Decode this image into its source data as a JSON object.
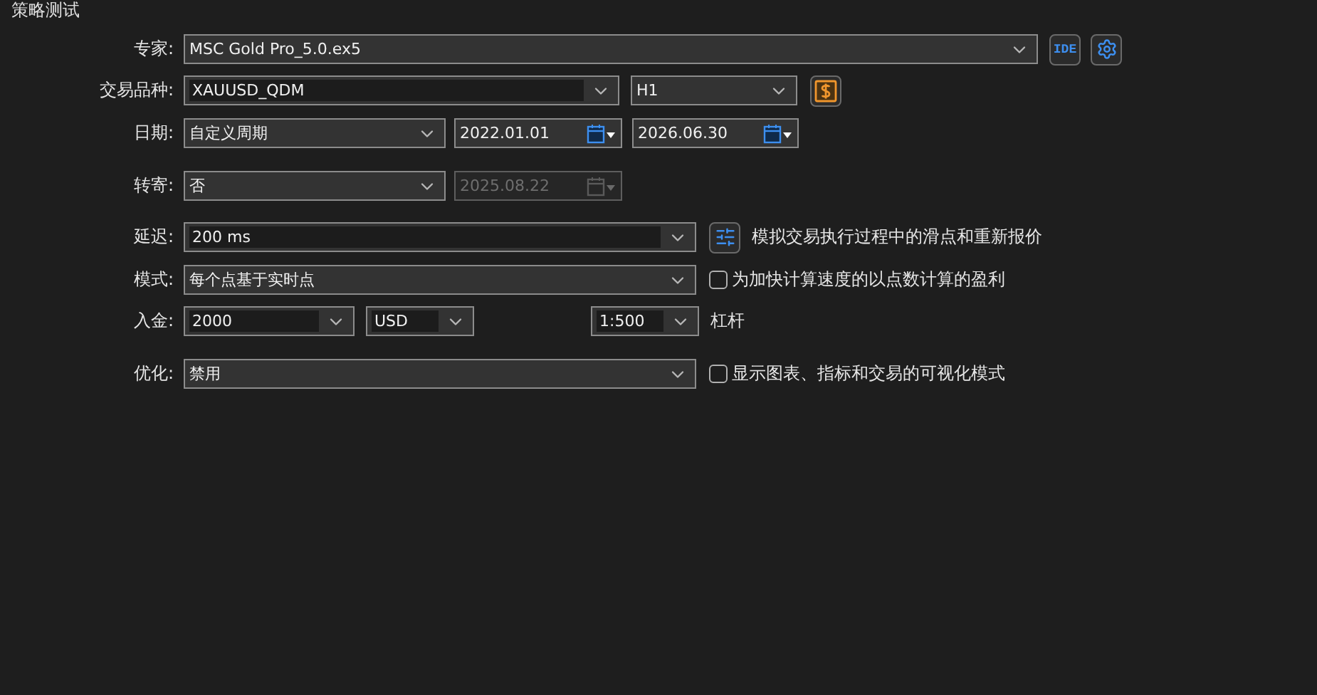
{
  "title": "策略测试",
  "rows": [
    {
      "label": "专家:",
      "controls": [
        {
          "kind": "select",
          "value": "MSC Gold Pro_5.0.ex5"
        },
        {
          "kind": "ide_button",
          "label": "IDE"
        },
        {
          "kind": "settings_button"
        }
      ]
    },
    {
      "label": "交易品种:",
      "controls": [
        {
          "kind": "combo",
          "value": "XAUUSD_QDM"
        },
        {
          "kind": "select",
          "value": "H1"
        },
        {
          "kind": "money_button"
        }
      ]
    },
    {
      "label": "日期:",
      "controls": [
        {
          "kind": "select",
          "value": "自定义周期"
        },
        {
          "kind": "date",
          "value": "2022.01.01",
          "disabled": false
        },
        {
          "kind": "date",
          "value": "2026.06.30",
          "disabled": false
        }
      ]
    },
    {
      "label": "转寄:",
      "controls": [
        {
          "kind": "select",
          "value": "否"
        },
        {
          "kind": "date",
          "value": "2025.08.22",
          "disabled": true
        }
      ]
    },
    {
      "label": "延迟:",
      "controls": [
        {
          "kind": "combo",
          "value": "200 ms"
        },
        {
          "kind": "sliders_button"
        },
        {
          "kind": "text",
          "label": "模拟交易执行过程中的滑点和重新报价"
        }
      ]
    },
    {
      "label": "模式:",
      "controls": [
        {
          "kind": "select",
          "value": "每个点基于实时点"
        },
        {
          "kind": "checkbox",
          "label": "为加快计算速度的以点数计算的盈利",
          "checked": false
        }
      ]
    },
    {
      "label": "入金:",
      "controls": [
        {
          "kind": "combo",
          "value": "2000"
        },
        {
          "kind": "combo",
          "value": "USD"
        },
        {
          "kind": "combo",
          "value": "1:500"
        },
        {
          "kind": "text",
          "label": "杠杆"
        }
      ]
    },
    {
      "label": "优化:",
      "controls": [
        {
          "kind": "select",
          "value": "禁用"
        },
        {
          "kind": "checkbox",
          "label": "显示图表、指标和交易的可视化模式",
          "checked": false
        }
      ]
    }
  ]
}
